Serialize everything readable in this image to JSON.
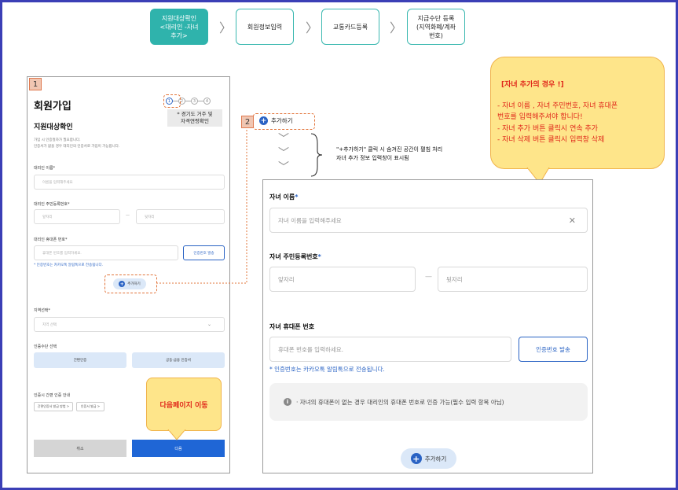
{
  "steps": [
    {
      "label": "지원대상확인\n<대리인 -자녀\n추가>",
      "active": true
    },
    {
      "label": "회원정보입력",
      "active": false
    },
    {
      "label": "교통카드등록",
      "active": false
    },
    {
      "label": "지급수단 등록\n(지역화폐/계좌\n번호)",
      "active": false
    }
  ],
  "step_chevron": "〉",
  "badges": {
    "one": "1",
    "two": "2"
  },
  "phone": {
    "title": "회원가입",
    "subtitle": "지원대상확인",
    "desc_line1": "가입 시 인증절차가 필요합니다.",
    "desc_line2": "인증서가 없을 경우 대리인의 인증서로 가입이 가능합니다.",
    "stepper": [
      "1",
      "2",
      "3",
      "4"
    ],
    "tag_text": "* 경기도 거주 및\n자격연령확인",
    "name_label": "대리인 이름*",
    "name_placeholder": "이름을 입력해주세요",
    "rrn_label": "대리인 주민등록번호*",
    "rrn_front": "앞자리",
    "rrn_dash": "—",
    "rrn_back": "뒷자리",
    "phone_label": "대리인 휴대폰 번호*",
    "phone_placeholder": "휴대폰 번호를 입력하세요.",
    "send_button": "인증번호 발송",
    "kakao_note": "* 인증번호는 카카오톡 알림톡으로 전송됩니다.",
    "add_button": "추가하기",
    "region_label": "지역선택*",
    "region_placeholder": "지역 선택",
    "auth_label": "인증수단 선택",
    "auth_simple": "간편인증",
    "auth_cert": "공동·금융 인증서",
    "guide_label": "인증시 간편 인증 안내",
    "chip1": "간편인증서 발급 방법 >",
    "chip2": "인증서 발급 >",
    "cancel": "취소",
    "next": "다음"
  },
  "add_header": "추가하기",
  "chevrons": [
    "﹀",
    "﹀",
    "﹀"
  ],
  "annotation": "\"+추가하기\" 클릭 시 숨겨진 공간이 펼침 처리\n자녀 추가 정보 입력창이 표시됨",
  "child": {
    "name_label": "자녀 이름",
    "name_placeholder": "자녀 이름을 입력해주세요",
    "clear_icon": "✕",
    "rrn_label": "자녀 주민등록번호",
    "rrn_front": "앞자리",
    "rrn_dash": "—",
    "rrn_back": "뒷자리",
    "phone_label": "자녀 휴대폰 번호",
    "phone_placeholder": "휴대폰 번호를 입력하세요.",
    "send_button": "인증번호 발송",
    "kakao_note": "* 인증번호는 카카오톡 알림톡으로 전송됩니다.",
    "info_text": "· 자녀의 휴대폰이 없는 경우 대리인의 휴대폰 번호로 인증 가능(필수 입력 항목 아님)",
    "add_button": "추가하기",
    "required_mark": "*"
  },
  "callout": {
    "title": "[자녀 추가의 경우 !]",
    "items": [
      "-   자녀 이름 , 자녀 주민번호, 자녀 휴대폰\n    번호를 입력해주셔야 합니다!",
      "-   자녀 추가 버튼 클릭시 연속 추가",
      "-   자녀 삭제 버튼 클릭시 입력창 삭제"
    ]
  },
  "next_callout": "다음페이지 이동",
  "colors": {
    "accent": "#2a63c4",
    "teal": "#2fb3ac",
    "frame": "#3b3fb6",
    "callout": "#fee58a",
    "red": "#e0281b"
  }
}
